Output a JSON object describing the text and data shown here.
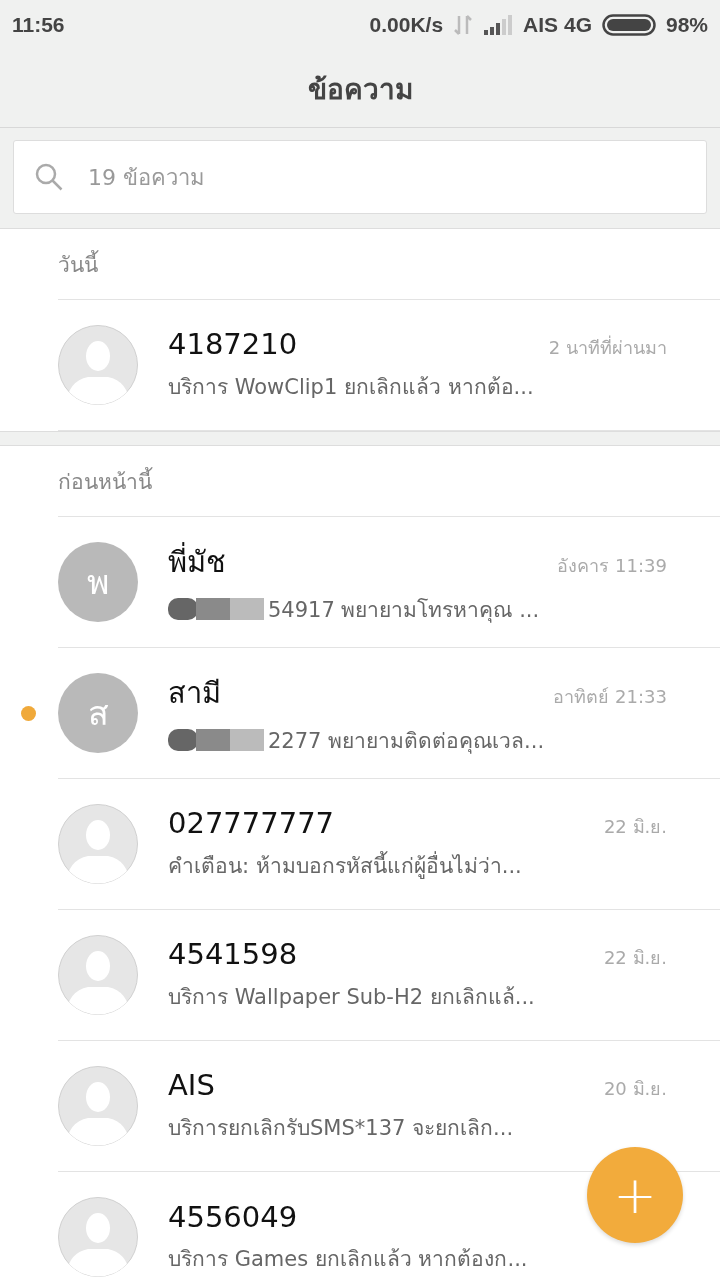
{
  "status_bar": {
    "time": "11:56",
    "speed": "0.00K/s",
    "carrier": "AIS 4G",
    "battery": "98%"
  },
  "title": "ข้อความ",
  "search": {
    "placeholder": "19 ข้อความ"
  },
  "sections": [
    {
      "label": "วันนี้",
      "conversations": [
        {
          "name": "4187210",
          "time": "2 นาทีที่ผ่านมา",
          "snippet": "บริการ WowClip1 ยกเลิกแล้ว หากต้อ...",
          "avatar": {
            "kind": "silhouette"
          },
          "unread": false,
          "redacted": false
        }
      ]
    },
    {
      "label": "ก่อนหน้านี้",
      "conversations": [
        {
          "name": "พี่มัช",
          "time": "อังคาร 11:39",
          "snippet": "54917 พยายามโทรหาคุณ ...",
          "avatar": {
            "kind": "initial",
            "letter": "พ"
          },
          "unread": false,
          "redacted": true
        },
        {
          "name": "สามี",
          "time": "อาทิตย์ 21:33",
          "snippet": "2277 พยายามติดต่อคุณเวล...",
          "avatar": {
            "kind": "initial",
            "letter": "ส"
          },
          "unread": true,
          "redacted": true
        },
        {
          "name": "027777777",
          "time": "22 มิ.ย.",
          "snippet": "คำเตือน: ห้ามบอกรหัสนี้แก่ผู้อื่นไม่ว่า...",
          "avatar": {
            "kind": "silhouette"
          },
          "unread": false,
          "redacted": false
        },
        {
          "name": "4541598",
          "time": "22 มิ.ย.",
          "snippet": "บริการ Wallpaper Sub-H2 ยกเลิกแล้...",
          "avatar": {
            "kind": "silhouette"
          },
          "unread": false,
          "redacted": false
        },
        {
          "name": "AIS",
          "time": "20 มิ.ย.",
          "snippet": "บริการยกเลิกรับSMS*137 จะยกเลิก...",
          "avatar": {
            "kind": "silhouette"
          },
          "unread": false,
          "redacted": false
        },
        {
          "name": "4556049",
          "snippet": "บริการ Games ยกเลิกแล้ว หากต้องก...",
          "avatar": {
            "kind": "silhouette"
          },
          "unread": false,
          "redacted": false
        }
      ]
    }
  ],
  "fab": {
    "label": "+"
  }
}
